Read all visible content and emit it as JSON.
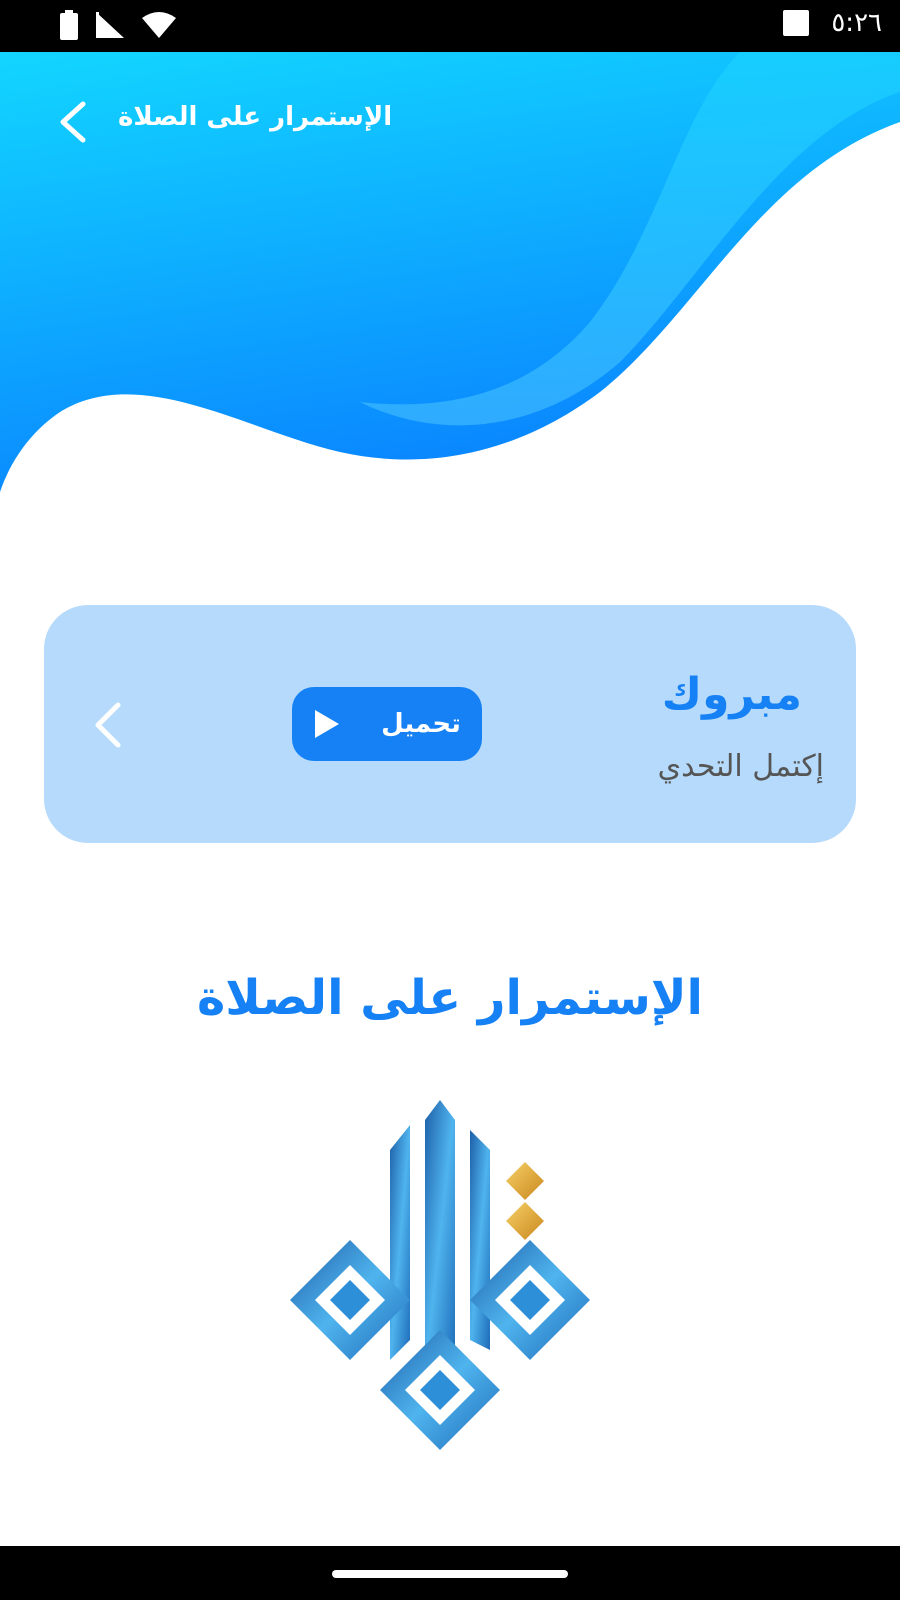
{
  "status_bar": {
    "time": "٥:٢٦",
    "icons": [
      "battery-icon",
      "signal-icon",
      "wifi-icon",
      "notification-square-icon"
    ]
  },
  "header": {
    "title": "الإستمرار على الصلاة",
    "back_icon": "chevron-left-icon"
  },
  "card": {
    "title": "مبروك",
    "subtitle": "إكتمل التحدي",
    "download_label": "تحميل",
    "download_icon": "play-icon",
    "nav_icon": "chevron-left-icon"
  },
  "main": {
    "title": "الإستمرار على الصلاة"
  },
  "colors": {
    "accent": "#1681f5",
    "card_bg": "#b5dafb",
    "wave_top": "#12d6ff",
    "wave_bottom": "#0a86ff",
    "subtitle": "#555555"
  }
}
